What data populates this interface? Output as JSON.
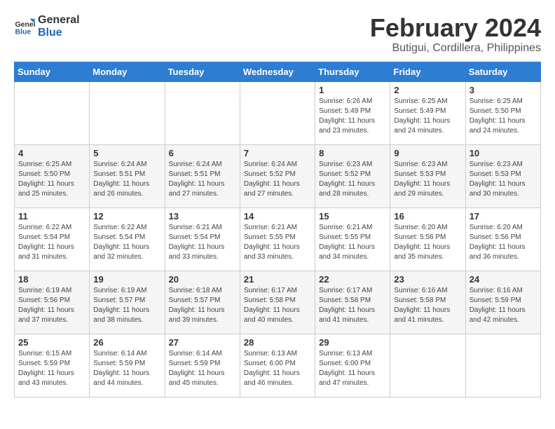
{
  "header": {
    "logo_line1": "General",
    "logo_line2": "Blue",
    "month_year": "February 2024",
    "location": "Butigui, Cordillera, Philippines"
  },
  "weekdays": [
    "Sunday",
    "Monday",
    "Tuesday",
    "Wednesday",
    "Thursday",
    "Friday",
    "Saturday"
  ],
  "weeks": [
    [
      {
        "day": "",
        "info": ""
      },
      {
        "day": "",
        "info": ""
      },
      {
        "day": "",
        "info": ""
      },
      {
        "day": "",
        "info": ""
      },
      {
        "day": "1",
        "info": "Sunrise: 6:26 AM\nSunset: 5:49 PM\nDaylight: 11 hours\nand 23 minutes."
      },
      {
        "day": "2",
        "info": "Sunrise: 6:25 AM\nSunset: 5:49 PM\nDaylight: 11 hours\nand 24 minutes."
      },
      {
        "day": "3",
        "info": "Sunrise: 6:25 AM\nSunset: 5:50 PM\nDaylight: 11 hours\nand 24 minutes."
      }
    ],
    [
      {
        "day": "4",
        "info": "Sunrise: 6:25 AM\nSunset: 5:50 PM\nDaylight: 11 hours\nand 25 minutes."
      },
      {
        "day": "5",
        "info": "Sunrise: 6:24 AM\nSunset: 5:51 PM\nDaylight: 11 hours\nand 26 minutes."
      },
      {
        "day": "6",
        "info": "Sunrise: 6:24 AM\nSunset: 5:51 PM\nDaylight: 11 hours\nand 27 minutes."
      },
      {
        "day": "7",
        "info": "Sunrise: 6:24 AM\nSunset: 5:52 PM\nDaylight: 11 hours\nand 27 minutes."
      },
      {
        "day": "8",
        "info": "Sunrise: 6:23 AM\nSunset: 5:52 PM\nDaylight: 11 hours\nand 28 minutes."
      },
      {
        "day": "9",
        "info": "Sunrise: 6:23 AM\nSunset: 5:53 PM\nDaylight: 11 hours\nand 29 minutes."
      },
      {
        "day": "10",
        "info": "Sunrise: 6:23 AM\nSunset: 5:53 PM\nDaylight: 11 hours\nand 30 minutes."
      }
    ],
    [
      {
        "day": "11",
        "info": "Sunrise: 6:22 AM\nSunset: 5:54 PM\nDaylight: 11 hours\nand 31 minutes."
      },
      {
        "day": "12",
        "info": "Sunrise: 6:22 AM\nSunset: 5:54 PM\nDaylight: 11 hours\nand 32 minutes."
      },
      {
        "day": "13",
        "info": "Sunrise: 6:21 AM\nSunset: 5:54 PM\nDaylight: 11 hours\nand 33 minutes."
      },
      {
        "day": "14",
        "info": "Sunrise: 6:21 AM\nSunset: 5:55 PM\nDaylight: 11 hours\nand 33 minutes."
      },
      {
        "day": "15",
        "info": "Sunrise: 6:21 AM\nSunset: 5:55 PM\nDaylight: 11 hours\nand 34 minutes."
      },
      {
        "day": "16",
        "info": "Sunrise: 6:20 AM\nSunset: 5:56 PM\nDaylight: 11 hours\nand 35 minutes."
      },
      {
        "day": "17",
        "info": "Sunrise: 6:20 AM\nSunset: 5:56 PM\nDaylight: 11 hours\nand 36 minutes."
      }
    ],
    [
      {
        "day": "18",
        "info": "Sunrise: 6:19 AM\nSunset: 5:56 PM\nDaylight: 11 hours\nand 37 minutes."
      },
      {
        "day": "19",
        "info": "Sunrise: 6:19 AM\nSunset: 5:57 PM\nDaylight: 11 hours\nand 38 minutes."
      },
      {
        "day": "20",
        "info": "Sunrise: 6:18 AM\nSunset: 5:57 PM\nDaylight: 11 hours\nand 39 minutes."
      },
      {
        "day": "21",
        "info": "Sunrise: 6:17 AM\nSunset: 5:58 PM\nDaylight: 11 hours\nand 40 minutes."
      },
      {
        "day": "22",
        "info": "Sunrise: 6:17 AM\nSunset: 5:58 PM\nDaylight: 11 hours\nand 41 minutes."
      },
      {
        "day": "23",
        "info": "Sunrise: 6:16 AM\nSunset: 5:58 PM\nDaylight: 11 hours\nand 41 minutes."
      },
      {
        "day": "24",
        "info": "Sunrise: 6:16 AM\nSunset: 5:59 PM\nDaylight: 11 hours\nand 42 minutes."
      }
    ],
    [
      {
        "day": "25",
        "info": "Sunrise: 6:15 AM\nSunset: 5:59 PM\nDaylight: 11 hours\nand 43 minutes."
      },
      {
        "day": "26",
        "info": "Sunrise: 6:14 AM\nSunset: 5:59 PM\nDaylight: 11 hours\nand 44 minutes."
      },
      {
        "day": "27",
        "info": "Sunrise: 6:14 AM\nSunset: 5:59 PM\nDaylight: 11 hours\nand 45 minutes."
      },
      {
        "day": "28",
        "info": "Sunrise: 6:13 AM\nSunset: 6:00 PM\nDaylight: 11 hours\nand 46 minutes."
      },
      {
        "day": "29",
        "info": "Sunrise: 6:13 AM\nSunset: 6:00 PM\nDaylight: 11 hours\nand 47 minutes."
      },
      {
        "day": "",
        "info": ""
      },
      {
        "day": "",
        "info": ""
      }
    ]
  ]
}
